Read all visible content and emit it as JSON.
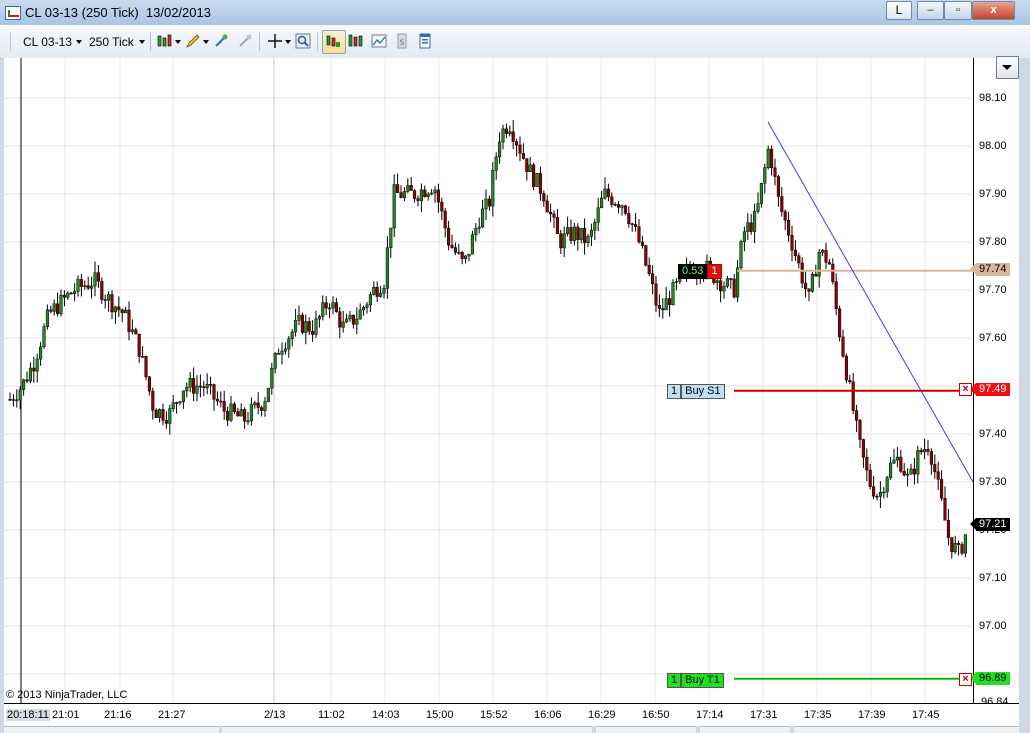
{
  "window": {
    "title": "CL 03-13 (250 Tick)  13/02/2013",
    "link_button": "L",
    "minimize": "–",
    "maximize": "▫",
    "close": "x"
  },
  "toolbar": {
    "instrument": "CL 03-13",
    "interval": "250 Tick",
    "icons": [
      "bar-type-icon",
      "drawing-tools-icon",
      "crosshair-icon",
      "zoom-icon",
      "chart-trader-icon",
      "data-box-icon",
      "properties-icon",
      "indicators-icon"
    ]
  },
  "colors": {
    "up_candle": "#1f8a1f",
    "down_candle": "#8b0000",
    "trend_line": "#3a3aff",
    "stop_line": "#cc0000",
    "target_line": "#00c000",
    "entry_line": "#d8b898"
  },
  "price_axis": {
    "ticks": [
      "98.10",
      "98.00",
      "97.90",
      "97.80",
      "97.70",
      "97.60",
      "97.40",
      "97.30",
      "97.20",
      "97.10",
      "97.00"
    ],
    "last_price": "97.21",
    "entry_price": "97.74",
    "stop_price": "97.49",
    "target_price": "96.89",
    "bottom_price": "96.84"
  },
  "time_axis": {
    "labels": [
      "20:18:11",
      "21:01",
      "21:16",
      "21:27",
      "2/13",
      "11:02",
      "14:03",
      "15:00",
      "15:52",
      "16:06",
      "16:29",
      "16:50",
      "17:14",
      "17:31",
      "17:35",
      "17:39",
      "17:45"
    ]
  },
  "position": {
    "pnl": "0.53",
    "quantity": "1"
  },
  "orders": {
    "stop": {
      "qty": "1",
      "label": "Buy S1"
    },
    "target": {
      "qty": "1",
      "label": "Buy T1"
    }
  },
  "copyright": "© 2013 NinjaTrader, LLC"
}
